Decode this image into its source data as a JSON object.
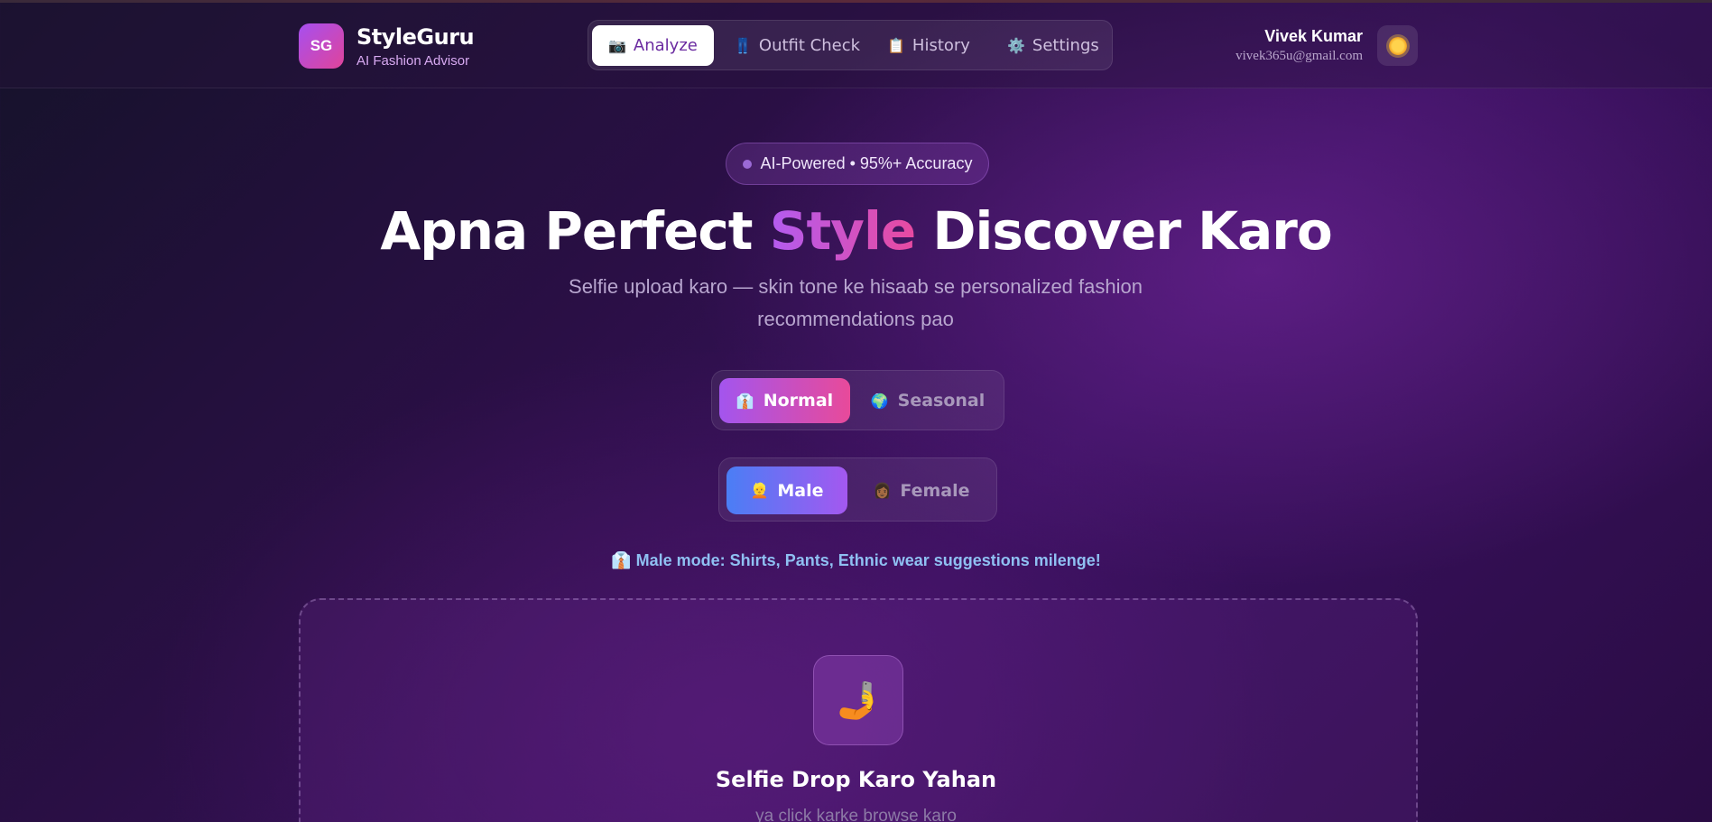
{
  "header": {
    "logo_text": "SG",
    "brand_name": "StyleGuru",
    "brand_sub": "AI Fashion Advisor",
    "nav": [
      {
        "icon": "📷",
        "label": "Analyze",
        "active": true
      },
      {
        "icon": "👖",
        "label": "Outfit Check",
        "active": false
      },
      {
        "icon": "📋",
        "label": "History",
        "active": false
      },
      {
        "icon": "⚙️",
        "label": "Settings",
        "active": false
      }
    ],
    "user_name": "Vivek Kumar",
    "user_email": "vivek365u@gmail.com",
    "theme_icon": "sun-icon"
  },
  "hero": {
    "pill": "AI-Powered • 95%+ Accuracy",
    "title_before": "Apna Perfect ",
    "title_accent": "Style",
    "title_after": " Discover Karo",
    "subtitle": "Selfie upload karo — skin tone ke hisaab se personalized fashion recommendations pao"
  },
  "mode_toggle": {
    "normal": {
      "icon": "👔",
      "label": "Normal",
      "selected": true
    },
    "seasonal": {
      "icon": "🌍",
      "label": "Seasonal",
      "selected": false
    }
  },
  "gender_toggle": {
    "male": {
      "icon": "👱",
      "label": "Male",
      "selected": true
    },
    "female": {
      "icon": "👩🏾",
      "label": "Female",
      "selected": false
    }
  },
  "mode_note": {
    "icon": "👔",
    "text": "Male mode: Shirts, Pants, Ethnic wear suggestions milenge!"
  },
  "dropzone": {
    "icon": "🤳",
    "title": "Selfie Drop Karo Yahan",
    "subtitle": "ya click karke browse karo"
  },
  "colors": {
    "accent_purple": "#a64ff0",
    "accent_pink": "#e0449a",
    "accent_blue": "#4a7ef5"
  }
}
